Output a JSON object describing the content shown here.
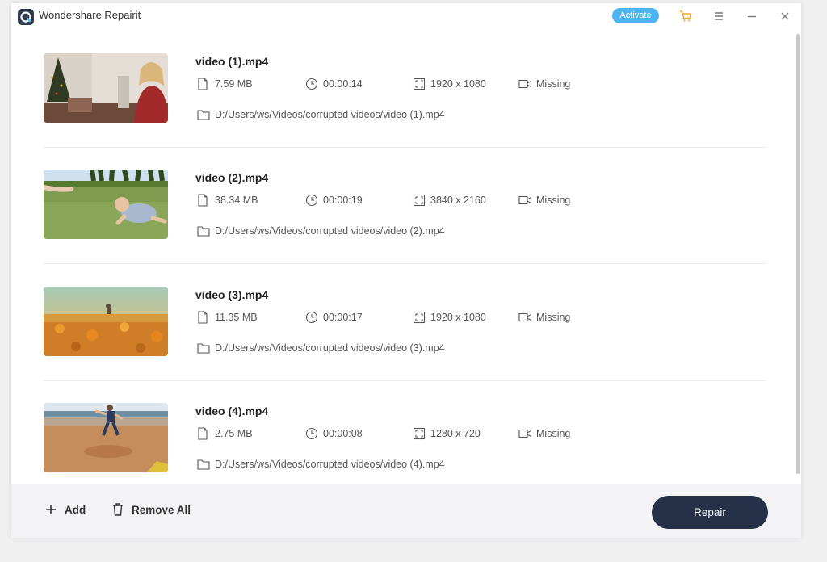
{
  "app": {
    "title": "Wondershare Repairit",
    "activate_label": "Activate"
  },
  "titlebar_icons": [
    "cart-icon",
    "menu-icon",
    "minimize-icon",
    "close-icon"
  ],
  "files": [
    {
      "name": "video (1).mp4",
      "size": "7.59  MB",
      "duration": "00:00:14",
      "resolution": "1920 x 1080",
      "audio": "Missing",
      "path": "D:/Users/ws/Videos/corrupted videos/video (1).mp4"
    },
    {
      "name": "video (2).mp4",
      "size": "38.34  MB",
      "duration": "00:00:19",
      "resolution": "3840 x 2160",
      "audio": "Missing",
      "path": "D:/Users/ws/Videos/corrupted videos/video (2).mp4"
    },
    {
      "name": "video (3).mp4",
      "size": "11.35  MB",
      "duration": "00:00:17",
      "resolution": "1920 x 1080",
      "audio": "Missing",
      "path": "D:/Users/ws/Videos/corrupted videos/video (3).mp4"
    },
    {
      "name": "video (4).mp4",
      "size": "2.75  MB",
      "duration": "00:00:08",
      "resolution": "1280 x 720",
      "audio": "Missing",
      "path": "D:/Users/ws/Videos/corrupted videos/video (4).mp4"
    }
  ],
  "footer": {
    "add_label": "Add",
    "remove_all_label": "Remove All",
    "repair_label": "Repair"
  },
  "colors": {
    "accent": "#4cb4f0",
    "repair_button": "#263049",
    "footer_bg": "#f3f3f5"
  }
}
